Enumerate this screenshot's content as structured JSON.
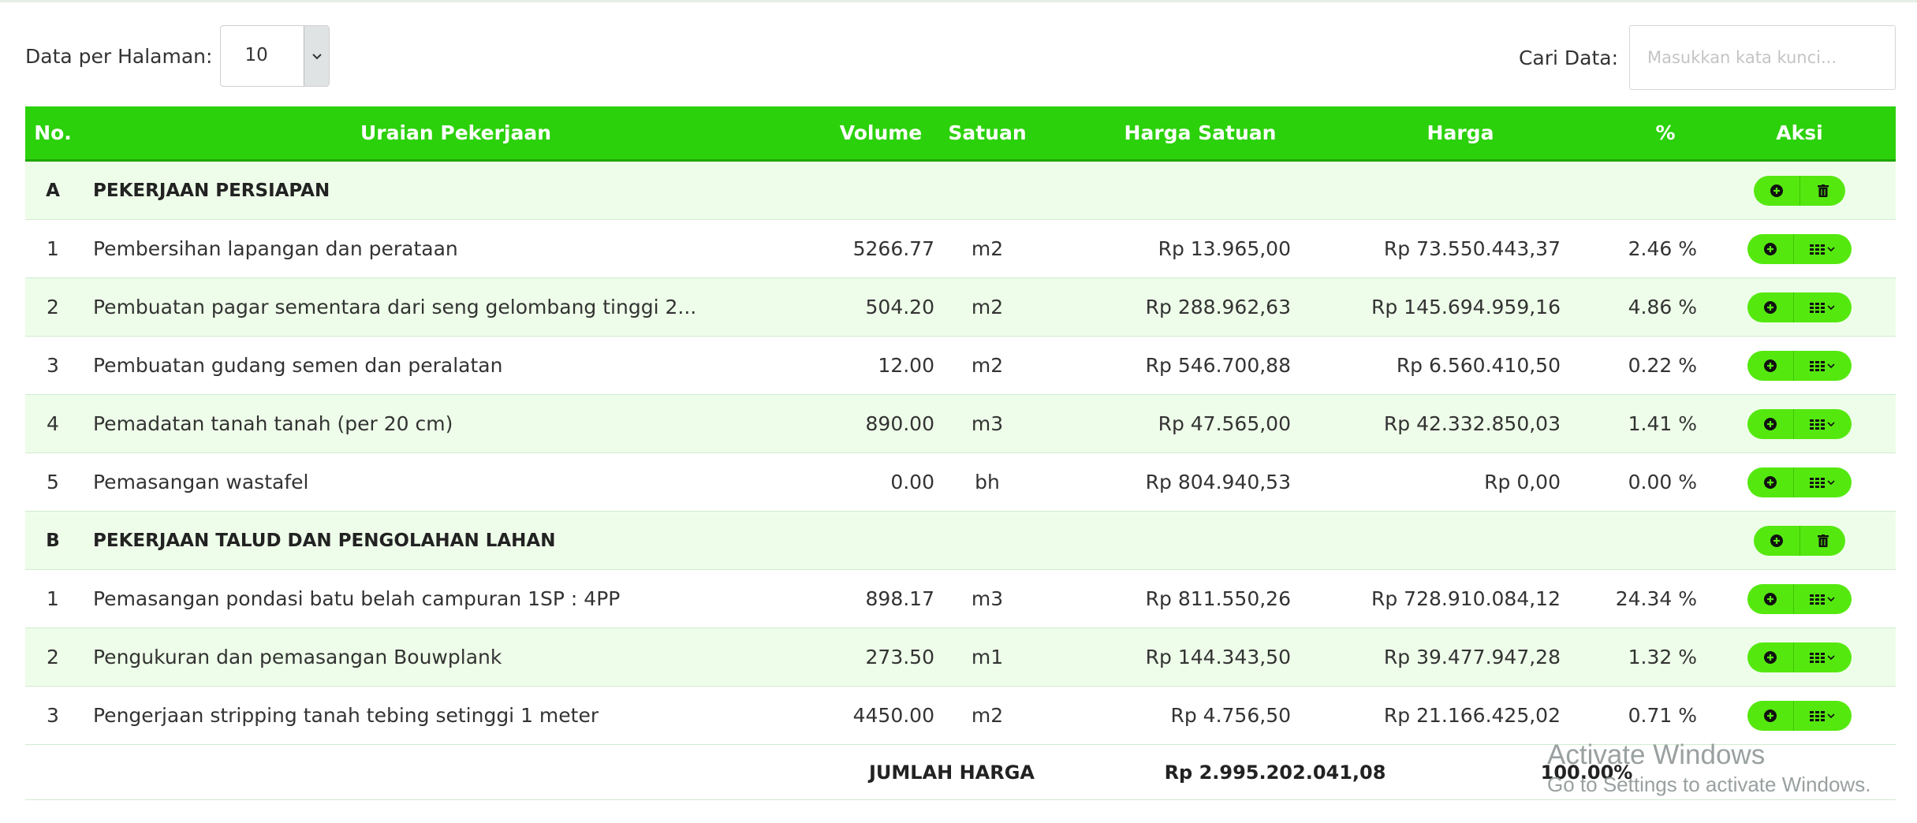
{
  "toolbar": {
    "per_page_label": "Data per Halaman:",
    "per_page_value": "10",
    "search_label": "Cari Data:",
    "search_placeholder": "Masukkan kata kunci...",
    "search_value": ""
  },
  "table": {
    "headers": {
      "no": "No.",
      "uraian": "Uraian Pekerjaan",
      "volume": "Volume",
      "satuan": "Satuan",
      "harga_satuan": "Harga Satuan",
      "harga": "Harga",
      "persen": "%",
      "aksi": "Aksi"
    },
    "rows": [
      {
        "type": "group",
        "no": "A",
        "uraian": "PEKERJAAN PERSIAPAN"
      },
      {
        "type": "item",
        "no": "1",
        "uraian": "Pembersihan lapangan dan perataan",
        "volume": "5266.77",
        "satuan": "m2",
        "harga_satuan": "Rp 13.965,00",
        "harga": "Rp 73.550.443,37",
        "persen": "2.46 %"
      },
      {
        "type": "item",
        "no": "2",
        "uraian": "Pembuatan pagar sementara dari seng gelombang tinggi 2...",
        "volume": "504.20",
        "satuan": "m2",
        "harga_satuan": "Rp 288.962,63",
        "harga": "Rp 145.694.959,16",
        "persen": "4.86 %"
      },
      {
        "type": "item",
        "no": "3",
        "uraian": "Pembuatan gudang semen dan peralatan",
        "volume": "12.00",
        "satuan": "m2",
        "harga_satuan": "Rp 546.700,88",
        "harga": "Rp 6.560.410,50",
        "persen": "0.22 %"
      },
      {
        "type": "item",
        "no": "4",
        "uraian": "Pemadatan tanah tanah (per 20 cm)",
        "volume": "890.00",
        "satuan": "m3",
        "harga_satuan": "Rp 47.565,00",
        "harga": "Rp 42.332.850,03",
        "persen": "1.41 %"
      },
      {
        "type": "item",
        "no": "5",
        "uraian": "Pemasangan wastafel",
        "volume": "0.00",
        "satuan": "bh",
        "harga_satuan": "Rp 804.940,53",
        "harga": "Rp 0,00",
        "persen": "0.00 %"
      },
      {
        "type": "group",
        "no": "B",
        "uraian": "PEKERJAAN TALUD DAN PENGOLAHAN LAHAN"
      },
      {
        "type": "item",
        "no": "1",
        "uraian": "Pemasangan pondasi batu belah campuran 1SP : 4PP",
        "volume": "898.17",
        "satuan": "m3",
        "harga_satuan": "Rp 811.550,26",
        "harga": "Rp 728.910.084,12",
        "persen": "24.34 %"
      },
      {
        "type": "item",
        "no": "2",
        "uraian": "Pengukuran dan pemasangan Bouwplank",
        "volume": "273.50",
        "satuan": "m1",
        "harga_satuan": "Rp 144.343,50",
        "harga": "Rp 39.477.947,28",
        "persen": "1.32 %"
      },
      {
        "type": "item",
        "no": "3",
        "uraian": "Pengerjaan stripping tanah tebing setinggi 1 meter",
        "volume": "4450.00",
        "satuan": "m2",
        "harga_satuan": "Rp 4.756,50",
        "harga": "Rp 21.166.425,02",
        "persen": "0.71 %"
      }
    ],
    "footer": {
      "label": "JUMLAH HARGA",
      "total": "Rp 2.995.202.041,08",
      "persen": "100.00%"
    }
  },
  "icons": {
    "add": "plus-circle-icon",
    "delete": "trash-icon",
    "menu": "grid-menu-icon"
  },
  "colors": {
    "header_green": "#2bd10a",
    "button_green": "#55e80f",
    "row_tint": "#eefde9"
  },
  "watermark": {
    "title": "Activate Windows",
    "subtitle": "Go to Settings to activate Windows."
  }
}
